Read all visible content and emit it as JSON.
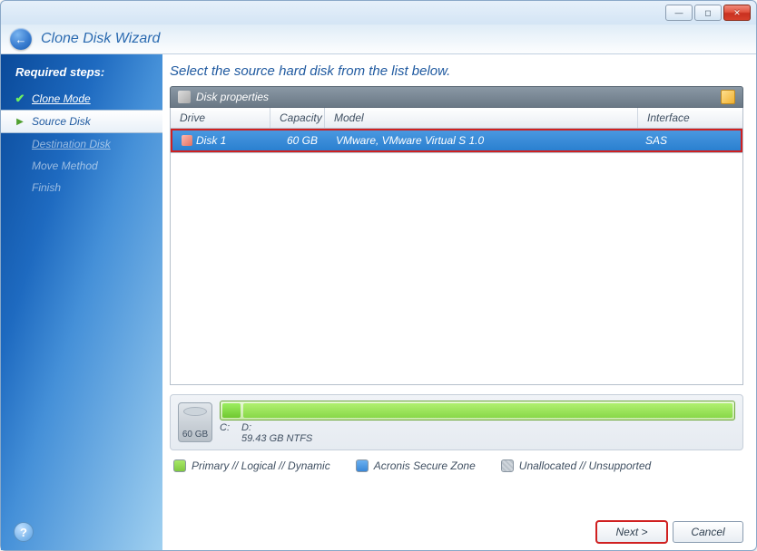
{
  "window": {
    "title": "Clone Disk Wizard"
  },
  "sidebar": {
    "header": "Required steps:",
    "steps": [
      {
        "label": "Clone Mode",
        "state": "done"
      },
      {
        "label": "Source Disk",
        "state": "current"
      },
      {
        "label": "Destination Disk",
        "state": "pending_underline"
      },
      {
        "label": "Move Method",
        "state": "pending"
      },
      {
        "label": "Finish",
        "state": "pending"
      }
    ]
  },
  "main": {
    "instruction": "Select the source hard disk from the list below.",
    "panel_title": "Disk properties",
    "columns": {
      "drive": "Drive",
      "capacity": "Capacity",
      "model": "Model",
      "interface": "Interface"
    },
    "rows": [
      {
        "drive": "Disk 1",
        "capacity": "60 GB",
        "model": "VMware, VMware Virtual S 1.0",
        "interface": "SAS"
      }
    ],
    "diskbar": {
      "total": "60 GB",
      "part_c_label": "C:",
      "part_d_label": "D:",
      "part_d_size": "59.43 GB  NTFS"
    },
    "legend": {
      "primary": "Primary // Logical // Dynamic",
      "secure": "Acronis Secure Zone",
      "unalloc": "Unallocated // Unsupported"
    }
  },
  "footer": {
    "next": "Next >",
    "cancel": "Cancel"
  }
}
